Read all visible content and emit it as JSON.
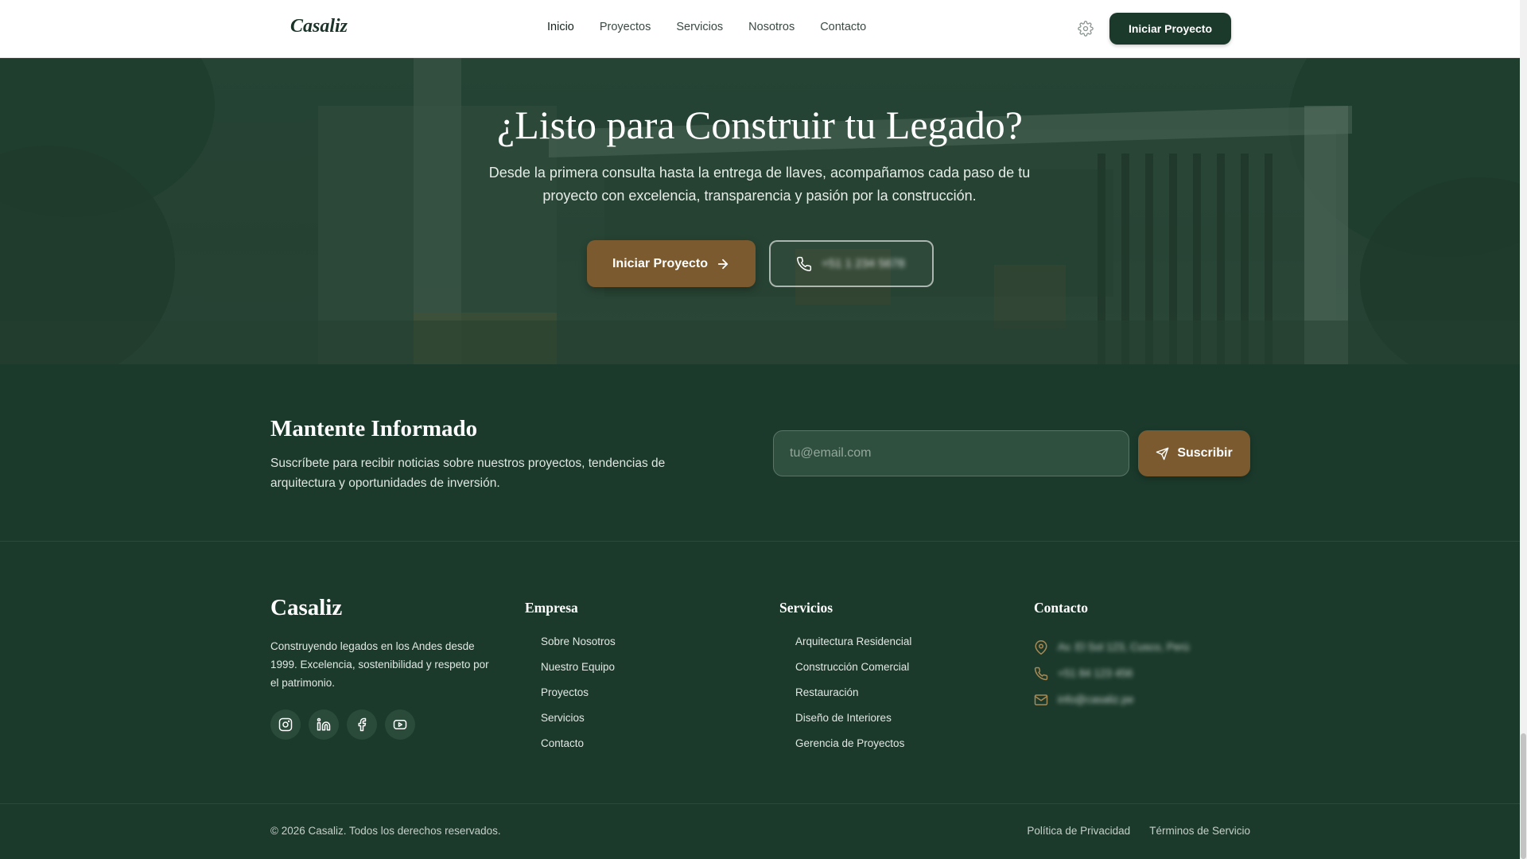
{
  "nav": {
    "logo": "Casaliz",
    "links": [
      "Inicio",
      "Proyectos",
      "Servicios",
      "Nosotros",
      "Contacto"
    ],
    "cta_label": "Iniciar Proyecto"
  },
  "hero": {
    "title": "¿Listo para Construir tu Legado?",
    "subtitle": "Desde la primera consulta hasta la entrega de llaves, acompañamos cada paso de tu proyecto con excelencia, transparencia y pasión por la construcción.",
    "primary_label": "Iniciar Proyecto",
    "phone_label": "+51 1 234 5678"
  },
  "newsletter": {
    "title": "Mantente Informado",
    "text": "Suscríbete para recibir noticias sobre nuestros proyectos, tendencias de arquitectura y oportunidades de inversión.",
    "email_placeholder": "tu@email.com",
    "button_label": "Suscribir"
  },
  "footer": {
    "brand": "Casaliz",
    "description": "Construyendo legados en los Andes desde 1999. Excelencia, sostenibilidad y respeto por el patrimonio.",
    "socials": [
      "instagram-icon",
      "linkedin-icon",
      "facebook-icon",
      "youtube-icon"
    ],
    "empresa": {
      "title": "Empresa",
      "items": [
        "Sobre Nosotros",
        "Nuestro Equipo",
        "Proyectos",
        "Servicios",
        "Contacto"
      ]
    },
    "servicios": {
      "title": "Servicios",
      "items": [
        "Arquitectura Residencial",
        "Construcción Comercial",
        "Restauración",
        "Diseño de Interiores",
        "Gerencia de Proyectos"
      ]
    },
    "contacto": {
      "title": "Contacto",
      "address": "Av. El Sol 123, Cusco, Perú",
      "phone": "+51 84 123 456",
      "email": "info@casaliz.pe"
    },
    "copyright": "© 2026 Casaliz. Todos los derechos reservados.",
    "legal": [
      "Política de Privacidad",
      "Términos de Servicio"
    ]
  },
  "colors": {
    "primary_green": "#1b3a2c",
    "accent_gold": "#7a5a2e",
    "contact_icon": "#a88a55"
  }
}
